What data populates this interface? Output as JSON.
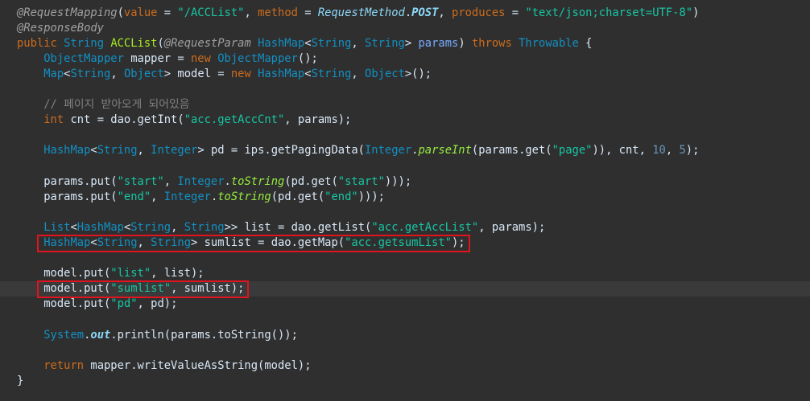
{
  "editor": {
    "lines": [
      [
        {
          "c": "ann",
          "t": "@RequestMapping"
        },
        {
          "c": "plain",
          "t": "("
        },
        {
          "c": "kw",
          "t": "value"
        },
        {
          "c": "plain",
          "t": " = "
        },
        {
          "c": "str",
          "t": "\"/ACCList\""
        },
        {
          "c": "plain",
          "t": ", "
        },
        {
          "c": "kw",
          "t": "method"
        },
        {
          "c": "plain",
          "t": " = "
        },
        {
          "c": "enumc",
          "t": "RequestMethod"
        },
        {
          "c": "plain",
          "t": "."
        },
        {
          "c": "sconst",
          "t": "POST"
        },
        {
          "c": "plain",
          "t": ", "
        },
        {
          "c": "kw",
          "t": "produces"
        },
        {
          "c": "plain",
          "t": " = "
        },
        {
          "c": "str",
          "t": "\"text/json;charset=UTF-8\""
        },
        {
          "c": "plain",
          "t": ")"
        }
      ],
      [
        {
          "c": "ann",
          "t": "@ResponseBody"
        }
      ],
      [
        {
          "c": "kw",
          "t": "public "
        },
        {
          "c": "type",
          "t": "String"
        },
        {
          "c": "plain",
          "t": " "
        },
        {
          "c": "meth",
          "t": "ACCList"
        },
        {
          "c": "plain",
          "t": "("
        },
        {
          "c": "ann",
          "t": "@RequestParam"
        },
        {
          "c": "plain",
          "t": " "
        },
        {
          "c": "type",
          "t": "HashMap"
        },
        {
          "c": "plain",
          "t": "<"
        },
        {
          "c": "type",
          "t": "String"
        },
        {
          "c": "plain",
          "t": ", "
        },
        {
          "c": "type",
          "t": "String"
        },
        {
          "c": "plain",
          "t": "> "
        },
        {
          "c": "var",
          "t": "params"
        },
        {
          "c": "plain",
          "t": ") "
        },
        {
          "c": "kw",
          "t": "throws"
        },
        {
          "c": "plain",
          "t": " "
        },
        {
          "c": "type",
          "t": "Throwable"
        },
        {
          "c": "plain",
          "t": " {"
        }
      ],
      [
        {
          "c": "plain",
          "t": "    "
        },
        {
          "c": "type",
          "t": "ObjectMapper"
        },
        {
          "c": "plain",
          "t": " mapper = "
        },
        {
          "c": "kw",
          "t": "new"
        },
        {
          "c": "plain",
          "t": " "
        },
        {
          "c": "type",
          "t": "ObjectMapper"
        },
        {
          "c": "plain",
          "t": "();"
        }
      ],
      [
        {
          "c": "plain",
          "t": "    "
        },
        {
          "c": "type",
          "t": "Map"
        },
        {
          "c": "plain",
          "t": "<"
        },
        {
          "c": "type",
          "t": "String"
        },
        {
          "c": "plain",
          "t": ", "
        },
        {
          "c": "type",
          "t": "Object"
        },
        {
          "c": "plain",
          "t": "> model = "
        },
        {
          "c": "kw",
          "t": "new"
        },
        {
          "c": "plain",
          "t": " "
        },
        {
          "c": "type",
          "t": "HashMap"
        },
        {
          "c": "plain",
          "t": "<"
        },
        {
          "c": "type",
          "t": "String"
        },
        {
          "c": "plain",
          "t": ", "
        },
        {
          "c": "type",
          "t": "Object"
        },
        {
          "c": "plain",
          "t": ">();"
        }
      ],
      [],
      [
        {
          "c": "plain",
          "t": "    "
        },
        {
          "c": "cmt",
          "t": "// 페이지 받아오게 되어있음"
        }
      ],
      [
        {
          "c": "plain",
          "t": "    "
        },
        {
          "c": "kw",
          "t": "int"
        },
        {
          "c": "plain",
          "t": " cnt = dao.getInt("
        },
        {
          "c": "str",
          "t": "\"acc.getAccCnt\""
        },
        {
          "c": "plain",
          "t": ", params);"
        }
      ],
      [],
      [
        {
          "c": "plain",
          "t": "    "
        },
        {
          "c": "type",
          "t": "HashMap"
        },
        {
          "c": "plain",
          "t": "<"
        },
        {
          "c": "type",
          "t": "String"
        },
        {
          "c": "plain",
          "t": ", "
        },
        {
          "c": "type",
          "t": "Integer"
        },
        {
          "c": "plain",
          "t": "> pd = ips.getPagingData("
        },
        {
          "c": "type",
          "t": "Integer"
        },
        {
          "c": "plain",
          "t": "."
        },
        {
          "c": "static",
          "t": "parseInt"
        },
        {
          "c": "plain",
          "t": "(params.get("
        },
        {
          "c": "str",
          "t": "\"page\""
        },
        {
          "c": "plain",
          "t": ")), cnt, "
        },
        {
          "c": "num",
          "t": "10"
        },
        {
          "c": "plain",
          "t": ", "
        },
        {
          "c": "num",
          "t": "5"
        },
        {
          "c": "plain",
          "t": ");"
        }
      ],
      [],
      [
        {
          "c": "plain",
          "t": "    params.put("
        },
        {
          "c": "str",
          "t": "\"start\""
        },
        {
          "c": "plain",
          "t": ", "
        },
        {
          "c": "type",
          "t": "Integer"
        },
        {
          "c": "plain",
          "t": "."
        },
        {
          "c": "static",
          "t": "toString"
        },
        {
          "c": "plain",
          "t": "(pd.get("
        },
        {
          "c": "str",
          "t": "\"start\""
        },
        {
          "c": "plain",
          "t": ")));"
        }
      ],
      [
        {
          "c": "plain",
          "t": "    params.put("
        },
        {
          "c": "str",
          "t": "\"end\""
        },
        {
          "c": "plain",
          "t": ", "
        },
        {
          "c": "type",
          "t": "Integer"
        },
        {
          "c": "plain",
          "t": "."
        },
        {
          "c": "static",
          "t": "toString"
        },
        {
          "c": "plain",
          "t": "(pd.get("
        },
        {
          "c": "str",
          "t": "\"end\""
        },
        {
          "c": "plain",
          "t": ")));"
        }
      ],
      [],
      [
        {
          "c": "plain",
          "t": "    "
        },
        {
          "c": "type",
          "t": "List"
        },
        {
          "c": "plain",
          "t": "<"
        },
        {
          "c": "type",
          "t": "HashMap"
        },
        {
          "c": "plain",
          "t": "<"
        },
        {
          "c": "type",
          "t": "String"
        },
        {
          "c": "plain",
          "t": ", "
        },
        {
          "c": "type",
          "t": "String"
        },
        {
          "c": "plain",
          "t": ">> list = dao.getList("
        },
        {
          "c": "str",
          "t": "\"acc.getAccList\""
        },
        {
          "c": "plain",
          "t": ", params);"
        }
      ],
      [
        {
          "c": "plain",
          "t": "    "
        },
        {
          "c": "type",
          "t": "HashMap"
        },
        {
          "c": "plain",
          "t": "<"
        },
        {
          "c": "type",
          "t": "String"
        },
        {
          "c": "plain",
          "t": ", "
        },
        {
          "c": "type",
          "t": "String"
        },
        {
          "c": "plain",
          "t": "> sumlist = dao.getMap("
        },
        {
          "c": "str",
          "t": "\"acc.getsumList\""
        },
        {
          "c": "plain",
          "t": ");"
        }
      ],
      [],
      [
        {
          "c": "plain",
          "t": "    model.put("
        },
        {
          "c": "str",
          "t": "\"list\""
        },
        {
          "c": "plain",
          "t": ", list);"
        }
      ],
      [
        {
          "c": "plain",
          "t": "    model.put("
        },
        {
          "c": "str",
          "t": "\"sumlist\""
        },
        {
          "c": "plain",
          "t": ", sumlist);"
        }
      ],
      [
        {
          "c": "plain",
          "t": "    model.put("
        },
        {
          "c": "str",
          "t": "\"pd\""
        },
        {
          "c": "plain",
          "t": ", pd);"
        }
      ],
      [],
      [
        {
          "c": "plain",
          "t": "    "
        },
        {
          "c": "type",
          "t": "System"
        },
        {
          "c": "plain",
          "t": "."
        },
        {
          "c": "sconst",
          "t": "out"
        },
        {
          "c": "plain",
          "t": ".println(params.toString());"
        }
      ],
      [],
      [
        {
          "c": "plain",
          "t": "    "
        },
        {
          "c": "kw",
          "t": "return"
        },
        {
          "c": "plain",
          "t": " mapper.writeValueAsString(model);"
        }
      ],
      [
        {
          "c": "plain",
          "t": "}"
        }
      ]
    ],
    "current_line_index": 18,
    "highlighted_line_indices": [
      15,
      18
    ]
  }
}
